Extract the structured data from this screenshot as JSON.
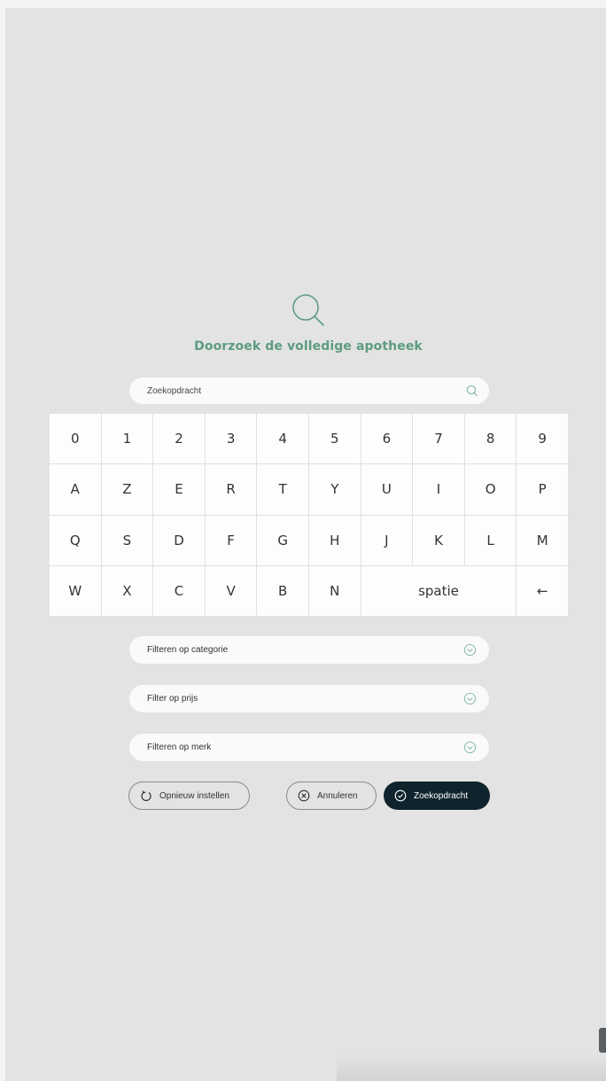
{
  "header": {
    "title": "Doorzoek de volledige apotheek",
    "icon": "search-icon"
  },
  "search": {
    "placeholder": "Zoekopdracht",
    "value": "",
    "icon": "search-icon"
  },
  "keyboard": {
    "row1": [
      "0",
      "1",
      "2",
      "3",
      "4",
      "5",
      "6",
      "7",
      "8",
      "9"
    ],
    "row2": [
      "A",
      "Z",
      "E",
      "R",
      "T",
      "Y",
      "U",
      "I",
      "O",
      "P"
    ],
    "row3": [
      "Q",
      "S",
      "D",
      "F",
      "G",
      "H",
      "J",
      "K",
      "L",
      "M"
    ],
    "row4": [
      "W",
      "X",
      "C",
      "V",
      "B",
      "N"
    ],
    "space_label": "spatie",
    "backspace_label": "←"
  },
  "filters": {
    "category": "Filteren op categorie",
    "price": "Filter op prijs",
    "brand": "Filteren op merk",
    "chevron_icon": "chevron-down-circle-icon"
  },
  "actions": {
    "reset_label": "Opnieuw instellen",
    "cancel_label": "Annuleren",
    "submit_label": "Zoekopdracht"
  },
  "colors": {
    "accent": "#5d9b80",
    "screen_bg": "#e3e3e3",
    "submit_bg": "#0f232c"
  }
}
